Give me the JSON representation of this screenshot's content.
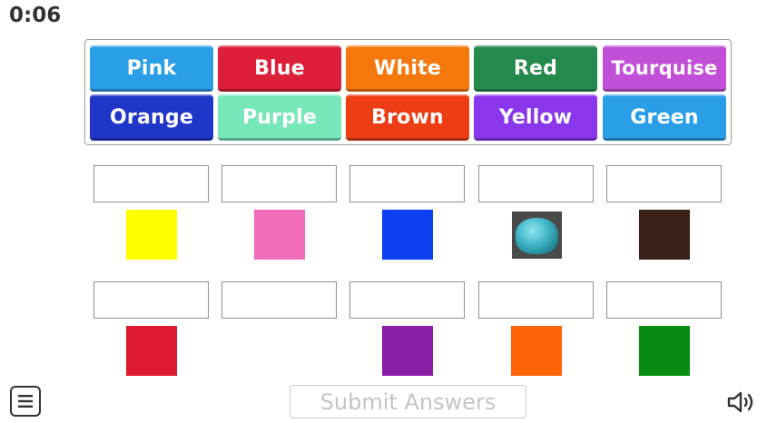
{
  "timer": "0:06",
  "word_tiles": [
    {
      "label": "Pink",
      "color": "#2a9fe8"
    },
    {
      "label": "Blue",
      "color": "#dd1f3a"
    },
    {
      "label": "White",
      "color": "#f5780d"
    },
    {
      "label": "Red",
      "color": "#25894d"
    },
    {
      "label": "Tourquise",
      "color": "#c24fd8"
    },
    {
      "label": "Orange",
      "color": "#1f36c8"
    },
    {
      "label": "Purple",
      "color": "#78e7b9"
    },
    {
      "label": "Brown",
      "color": "#ec3d14"
    },
    {
      "label": "Yellow",
      "color": "#8a36ec"
    },
    {
      "label": "Green",
      "color": "#2a9fe8"
    }
  ],
  "swatch_colors": [
    "#ffff00",
    "#f06cbb",
    "#0b3ff0",
    "turquoise-pompom-image",
    "#3a2119",
    "#dd1a2f",
    "#8a1ea8",
    "#ff640a",
    "#078c12"
  ],
  "footer": {
    "submit_label": "Submit Answers",
    "menu_icon": "menu-icon",
    "sound_icon": "speaker-icon"
  }
}
